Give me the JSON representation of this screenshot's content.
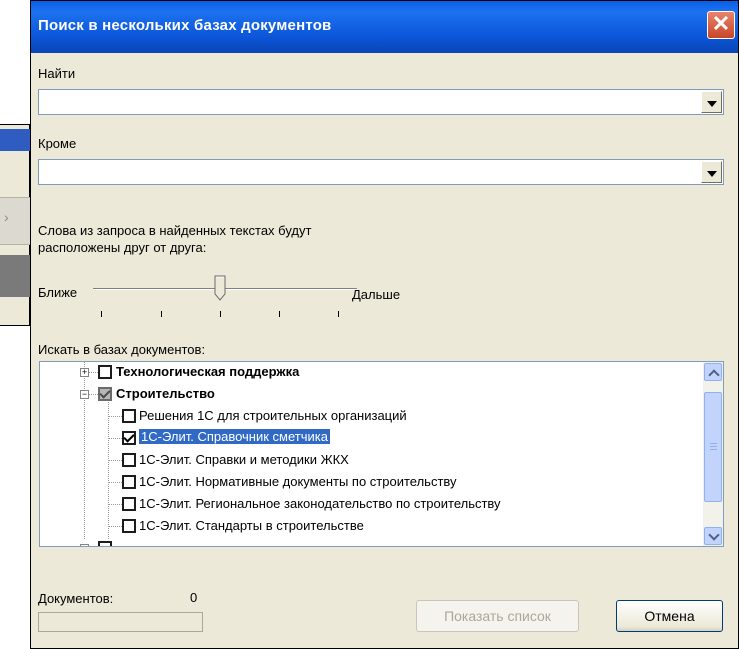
{
  "dialog": {
    "title": "Поиск в нескольких базах документов",
    "close_glyph": "✕"
  },
  "find": {
    "label": "Найти",
    "value": ""
  },
  "except": {
    "label": "Кроме",
    "value": ""
  },
  "proximity": {
    "description_line1": "Слова из запроса в найденных текстах будут",
    "description_line2": "расположены друг от друга:",
    "left_label": "Ближе",
    "right_label": "Дальше",
    "level": 0.5
  },
  "tree": {
    "label": "Искать в базах документов:",
    "items": [
      {
        "text": "Технологическая поддержка",
        "bold": true,
        "level": 0,
        "expander": "+",
        "checked": false,
        "partial": false
      },
      {
        "text": "Строительство",
        "bold": true,
        "level": 0,
        "expander": "−",
        "checked": false,
        "partial": true
      },
      {
        "text": "Решения 1С для строительных организаций",
        "bold": false,
        "level": 1,
        "checked": false
      },
      {
        "text": "1С-Элит. Справочник сметчика",
        "bold": false,
        "level": 1,
        "checked": true,
        "selected": true
      },
      {
        "text": "1С-Элит. Справки и методики ЖКХ",
        "bold": false,
        "level": 1,
        "checked": false
      },
      {
        "text": "1С-Элит. Нормативные документы по строительству",
        "bold": false,
        "level": 1,
        "checked": false
      },
      {
        "text": "1С-Элит. Региональное законодательство по строительству",
        "bold": false,
        "level": 1,
        "checked": false
      },
      {
        "text": "1С-Элит. Стандарты в строительстве",
        "bold": false,
        "level": 1,
        "checked": false
      }
    ]
  },
  "documents": {
    "label": "Документов:",
    "count": "0"
  },
  "buttons": {
    "show_list": "Показать список",
    "cancel": "Отмена"
  },
  "colors": {
    "titlebar": "#0a5ee6",
    "selection": "#316ac5",
    "dialog_bg": "#ece9d8"
  }
}
